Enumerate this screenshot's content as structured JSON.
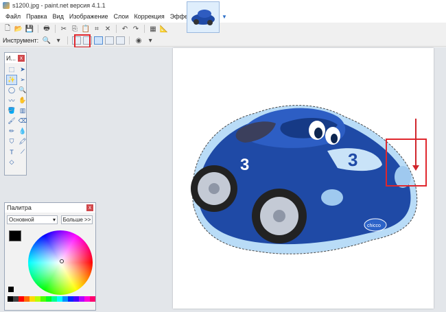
{
  "window": {
    "title": "s1200.jpg - paint.net версия 4.1.1"
  },
  "menu": [
    "Файл",
    "Правка",
    "Вид",
    "Изображение",
    "Слои",
    "Коррекция",
    "Эффекты"
  ],
  "toolbar2": {
    "tool_label": "Инструмент:"
  },
  "tools_panel": {
    "title": "И..."
  },
  "palette": {
    "title": "Палитра",
    "mode": "Основной",
    "more_button": "Больше >>",
    "close": "x"
  },
  "canvas": {
    "car_number": "3",
    "brand": "chicco"
  },
  "colors": {
    "annotation_red": "#e0262c",
    "car_blue": "#1f4aa6",
    "selection_glow": "#b9dcf7"
  }
}
